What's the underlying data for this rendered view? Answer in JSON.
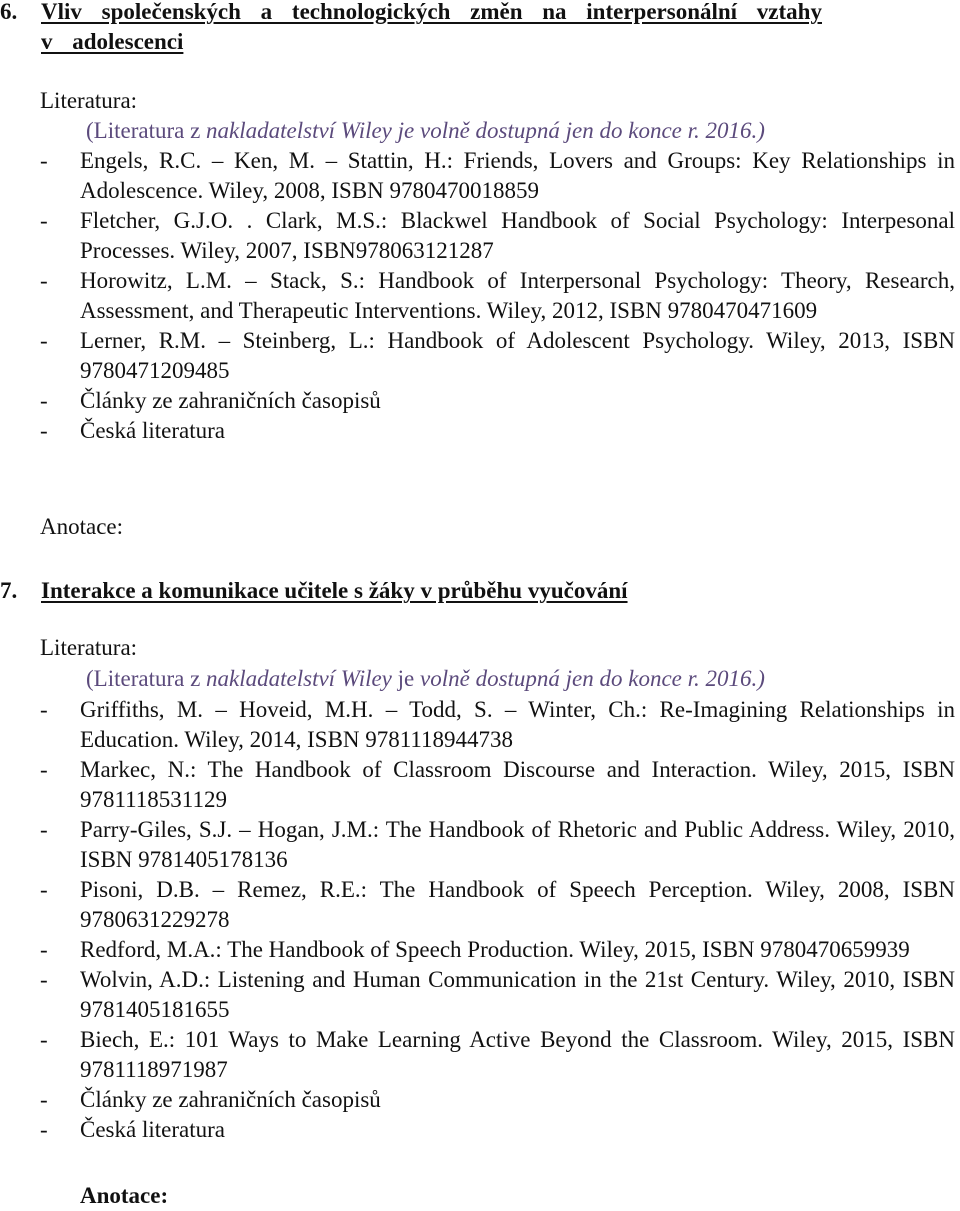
{
  "sections": [
    {
      "number": "6.",
      "title_line1": "Vliv společenských a technologických změn na interpersonální vztahy",
      "title_line2": "v adolescenci",
      "literature_label": "Literatura:",
      "note": {
        "open": "(Literatura z ",
        "italic": "nakladatelství Wiley  je volně dostupná jen do konce r. 2016.)"
      },
      "items": [
        {
          "dash": "-",
          "text": "Engels, R.C. – Ken, M. – Stattin, H.: Friends, Lovers and Groups: Key Relationships in Adolescence. Wiley, 2008, ISBN 9780470018859"
        },
        {
          "dash": "-",
          "text": "Fletcher, G.J.O. . Clark, M.S.: Blackwel Handbook of Social Psychology: Interpesonal Processes. Wiley, 2007, ISBN978063121287"
        },
        {
          "dash": "-",
          "text": "Horowitz, L.M. – Stack, S.: Handbook of Interpersonal Psychology: Theory, Research, Assessment, and Therapeutic Interventions. Wiley, 2012, ISBN 9780470471609"
        },
        {
          "dash": "-",
          "text": "Lerner, R.M. – Steinberg, L.: Handbook of Adolescent Psychology. Wiley, 2013, ISBN 9780471209485"
        },
        {
          "dash": "-",
          "text": "Články ze zahraničních časopisů"
        },
        {
          "dash": "-",
          "text": "Česká literatura"
        }
      ],
      "annotation_label": "Anotace:"
    },
    {
      "number": "7.",
      "title_line1": "Interakce a komunikace učitele s žáky v průběhu vyučování",
      "literature_label": "Literatura:",
      "note": {
        "open": "(Literatura z ",
        "italic_a": "nakladatelství Wiley",
        "middle": " je ",
        "italic_b": "volně dostupná jen do konce r. 2016.)"
      },
      "items": [
        {
          "dash": "-",
          "text": "Griffiths, M. – Hoveid, M.H. – Todd, S. – Winter, Ch.: Re-Imagining Relationships in Education. Wiley, 2014, ISBN 9781118944738"
        },
        {
          "dash": "-",
          "text": "Markec, N.: The Handbook of Classroom Discourse and Interaction. Wiley, 2015, ISBN 9781118531129"
        },
        {
          "dash": "-",
          "text": "Parry-Giles, S.J. – Hogan, J.M.: The Handbook of Rhetoric and Public Address. Wiley, 2010, ISBN 9781405178136"
        },
        {
          "dash": "-",
          "text": "Pisoni, D.B. – Remez, R.E.: The Handbook of Speech Perception. Wiley, 2008, ISBN 9780631229278"
        },
        {
          "dash": "-",
          "text": "Redford, M.A.: The Handbook of Speech Production. Wiley, 2015, ISBN 9780470659939"
        },
        {
          "dash": "-",
          "text": "Wolvin, A.D.: Listening and Human Communication in the 21st Century. Wiley, 2010, ISBN 9781405181655"
        },
        {
          "dash": "-",
          "text": "Biech, E.: 101 Ways to Make Learning Active Beyond the Classroom. Wiley, 2015, ISBN 9781118971987"
        },
        {
          "dash": "-",
          "text": "Články ze zahraničních časopisů"
        },
        {
          "dash": "-",
          "text": "Česká literatura"
        }
      ],
      "annotation_label": "Anotace:"
    }
  ]
}
